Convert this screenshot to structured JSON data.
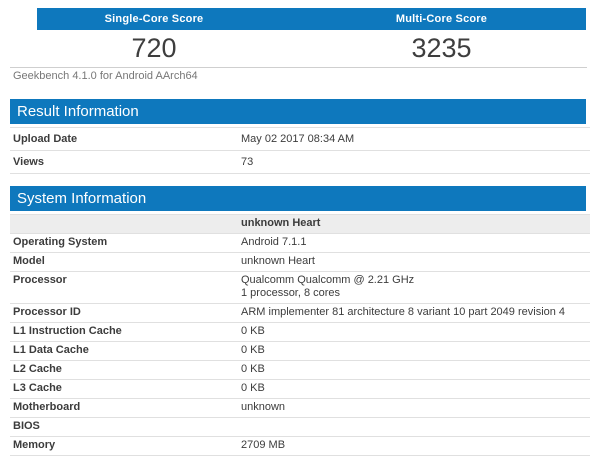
{
  "accent_color": "#0e78bd",
  "score_banner": {
    "columns": [
      {
        "label": "Single-Core Score",
        "score": "720"
      },
      {
        "label": "Multi-Core Score",
        "score": "3235"
      }
    ]
  },
  "caption": "Geekbench 4.1.0 for Android AArch64",
  "result_information": {
    "title": "Result Information",
    "rows": [
      {
        "label": "Upload Date",
        "value": "May 02 2017 08:34 AM"
      },
      {
        "label": "Views",
        "value": "73"
      }
    ]
  },
  "system_information": {
    "title": "System Information",
    "device_header": "unknown Heart",
    "rows": [
      {
        "label": "Operating System",
        "value": "Android 7.1.1"
      },
      {
        "label": "Model",
        "value": "unknown Heart"
      },
      {
        "label": "Processor",
        "value": "Qualcomm Qualcomm @ 2.21 GHz",
        "value2": "1 processor, 8 cores"
      },
      {
        "label": "Processor ID",
        "value": "ARM implementer 81 architecture 8 variant 10 part 2049 revision 4"
      },
      {
        "label": "L1 Instruction Cache",
        "value": "0 KB"
      },
      {
        "label": "L1 Data Cache",
        "value": "0 KB"
      },
      {
        "label": "L2 Cache",
        "value": "0 KB"
      },
      {
        "label": "L3 Cache",
        "value": "0 KB"
      },
      {
        "label": "Motherboard",
        "value": "unknown"
      },
      {
        "label": "BIOS",
        "value": ""
      },
      {
        "label": "Memory",
        "value": "2709 MB"
      }
    ]
  }
}
